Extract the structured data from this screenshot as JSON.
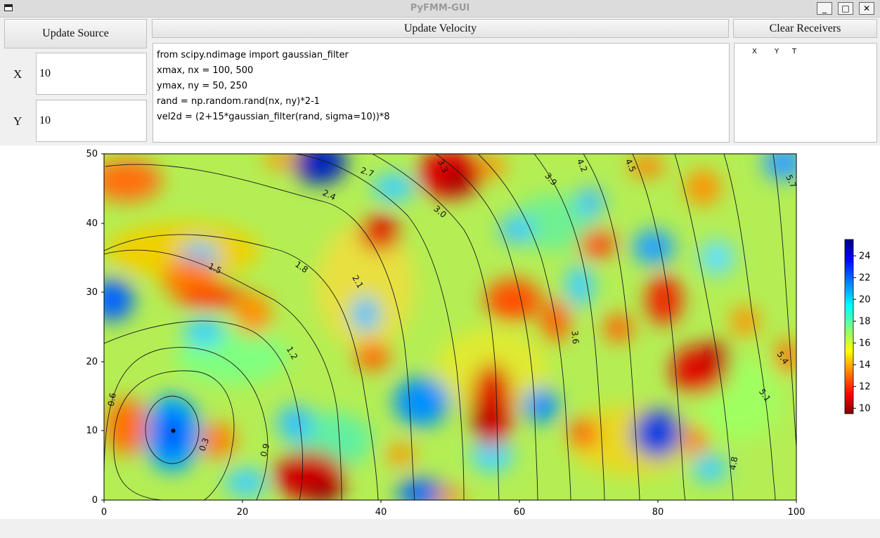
{
  "window": {
    "title": "PyFMM-GUI",
    "minimize": "_",
    "maximize": "□",
    "close": "✕"
  },
  "source": {
    "update_label": "Update Source",
    "x_label": "X",
    "y_label": "Y",
    "x_value": "10",
    "y_value": "10"
  },
  "velocity": {
    "update_label": "Update Velocity",
    "code_lines": [
      "from scipy.ndimage import gaussian_filter",
      "xmax, nx = 100, 500",
      "ymax, ny = 50, 250",
      "rand = np.random.rand(nx, ny)*2-1",
      "vel2d = (2+15*gaussian_filter(rand, sigma=10))*8"
    ]
  },
  "receivers": {
    "clear_label": "Clear Receivers",
    "columns": [
      "X",
      "Y",
      "T"
    ]
  },
  "chart_data": {
    "type": "heatmap",
    "title": "",
    "xlabel": "",
    "ylabel": "",
    "xlim": [
      0,
      100
    ],
    "ylim": [
      0,
      50
    ],
    "x_ticks": [
      "0",
      "20",
      "40",
      "60",
      "80",
      "100"
    ],
    "y_ticks": [
      "0",
      "10",
      "20",
      "30",
      "40",
      "50"
    ],
    "colormap": "jet",
    "colorbar": {
      "range": [
        9.5,
        25.5
      ],
      "ticks": [
        "10",
        "12",
        "14",
        "16",
        "18",
        "20",
        "22",
        "24"
      ]
    },
    "source_point": {
      "x": 10,
      "y": 10
    },
    "contour_labels": [
      {
        "text": "0.3",
        "x": 14.5,
        "y": 8,
        "angle": -70
      },
      {
        "text": "0.6",
        "x": 1.2,
        "y": 14.5,
        "angle": -80
      },
      {
        "text": "0.9",
        "x": 23.3,
        "y": 7.2,
        "angle": -75
      },
      {
        "text": "1.2",
        "x": 27.1,
        "y": 21.2,
        "angle": 60
      },
      {
        "text": "1.5",
        "x": 16,
        "y": 33.4,
        "angle": 25
      },
      {
        "text": "1.8",
        "x": 28.5,
        "y": 33.6,
        "angle": 35
      },
      {
        "text": "2.1",
        "x": 36.6,
        "y": 31.5,
        "angle": 60
      },
      {
        "text": "2.4",
        "x": 32.5,
        "y": 44,
        "angle": 25
      },
      {
        "text": "2.7",
        "x": 38,
        "y": 47.3,
        "angle": 20
      },
      {
        "text": "3.0",
        "x": 48.5,
        "y": 41.6,
        "angle": 40
      },
      {
        "text": "3.3",
        "x": 48.9,
        "y": 48.2,
        "angle": 65
      },
      {
        "text": "3.6",
        "x": 68,
        "y": 23.5,
        "angle": 85
      },
      {
        "text": "3.9",
        "x": 64.5,
        "y": 46.3,
        "angle": 50
      },
      {
        "text": "4.2",
        "x": 69,
        "y": 48.3,
        "angle": 65
      },
      {
        "text": "4.5",
        "x": 76,
        "y": 48.3,
        "angle": 65
      },
      {
        "text": "4.8",
        "x": 91,
        "y": 5.3,
        "angle": -80
      },
      {
        "text": "5.1",
        "x": 95.4,
        "y": 15.1,
        "angle": 55
      },
      {
        "text": "5.4",
        "x": 98,
        "y": 20.5,
        "angle": 55
      },
      {
        "text": "5.7",
        "x": 99.2,
        "y": 46,
        "angle": 65
      }
    ]
  }
}
